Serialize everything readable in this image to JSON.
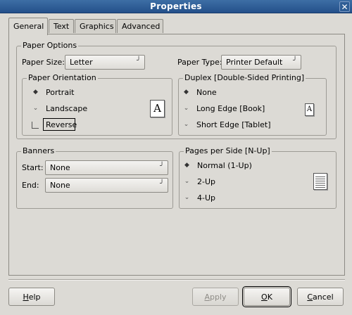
{
  "window": {
    "title": "Properties"
  },
  "tabs": [
    {
      "label": "General"
    },
    {
      "label": "Text"
    },
    {
      "label": "Graphics"
    },
    {
      "label": "Advanced"
    }
  ],
  "paper_options": {
    "legend": "Paper Options",
    "paper_size_label": "Paper Size:",
    "paper_size_value": "Letter",
    "paper_type_label": "Paper Type:",
    "paper_type_value": "Printer Default"
  },
  "orientation": {
    "legend": "Paper Orientation",
    "options": [
      {
        "label": "Portrait",
        "selected": true
      },
      {
        "label": "Landscape",
        "selected": false
      }
    ],
    "reverse_label": "Reverse",
    "preview_glyph": "A"
  },
  "duplex": {
    "legend": "Duplex [Double-Sided Printing]",
    "options": [
      {
        "label": "None",
        "selected": true
      },
      {
        "label": "Long Edge [Book]",
        "selected": false
      },
      {
        "label": "Short Edge [Tablet]",
        "selected": false
      }
    ],
    "preview_glyph": "A"
  },
  "banners": {
    "legend": "Banners",
    "start_label": "Start:",
    "start_value": "None",
    "end_label": "End:",
    "end_value": "None"
  },
  "nup": {
    "legend": "Pages per Side [N-Up]",
    "options": [
      {
        "label": "Normal (1-Up)",
        "selected": true
      },
      {
        "label": "2-Up",
        "selected": false
      },
      {
        "label": "4-Up",
        "selected": false
      }
    ]
  },
  "buttons": {
    "help": {
      "mn": "H",
      "rest": "elp"
    },
    "apply": {
      "mn": "A",
      "rest": "pply"
    },
    "ok": {
      "mn": "O",
      "rest": "K"
    },
    "cancel": {
      "mn": "C",
      "rest": "ancel"
    }
  },
  "icons": {
    "close": "close-icon",
    "radio_on": "radio-selected-icon",
    "radio_off": "radio-unselected-icon",
    "combo_arrow": "combo-arrow-icon"
  }
}
